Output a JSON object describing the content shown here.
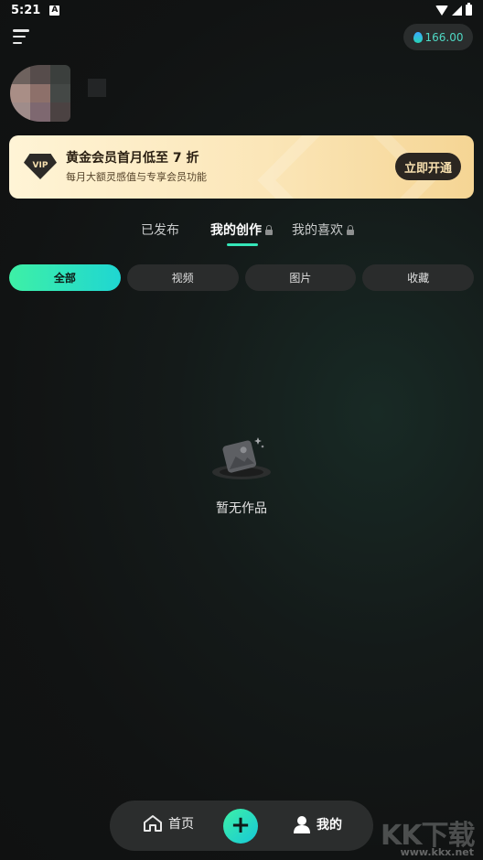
{
  "status_bar": {
    "time": "5:21",
    "notification_icon": "a-icon"
  },
  "header": {
    "menu_icon": "menu-icon",
    "credits": "166.00"
  },
  "profile": {
    "avatar_colors": [
      "#6e625e",
      "#564c4b",
      "#3b3f3d",
      "#a98e86",
      "#8d706a",
      "#444846",
      "#9f8c8a",
      "#7e6870",
      "#4b4242"
    ]
  },
  "vip_banner": {
    "badge": "VIP",
    "title": "黄金会员首月低至 7 折",
    "subtitle": "每月大额灵感值与专享会员功能",
    "button": "立即开通"
  },
  "tabs": [
    {
      "label": "已发布",
      "active": false,
      "locked": false
    },
    {
      "label": "我的创作",
      "active": true,
      "locked": true
    },
    {
      "label": "我的喜欢",
      "active": false,
      "locked": true
    }
  ],
  "filters": [
    {
      "label": "全部",
      "active": true
    },
    {
      "label": "视频",
      "active": false
    },
    {
      "label": "图片",
      "active": false
    },
    {
      "label": "收藏",
      "active": false
    }
  ],
  "empty_state": {
    "icon": "empty-box-icon",
    "text": "暂无作品"
  },
  "bottom_nav": {
    "home": "首页",
    "add": "+",
    "mine": "我的"
  },
  "watermark": {
    "big": "KK下载",
    "small": "www.kkx.net"
  },
  "colors": {
    "accent_start": "#3ef0a6",
    "accent_end": "#1fd6d2",
    "vip_gold": "#fbe6b8"
  }
}
